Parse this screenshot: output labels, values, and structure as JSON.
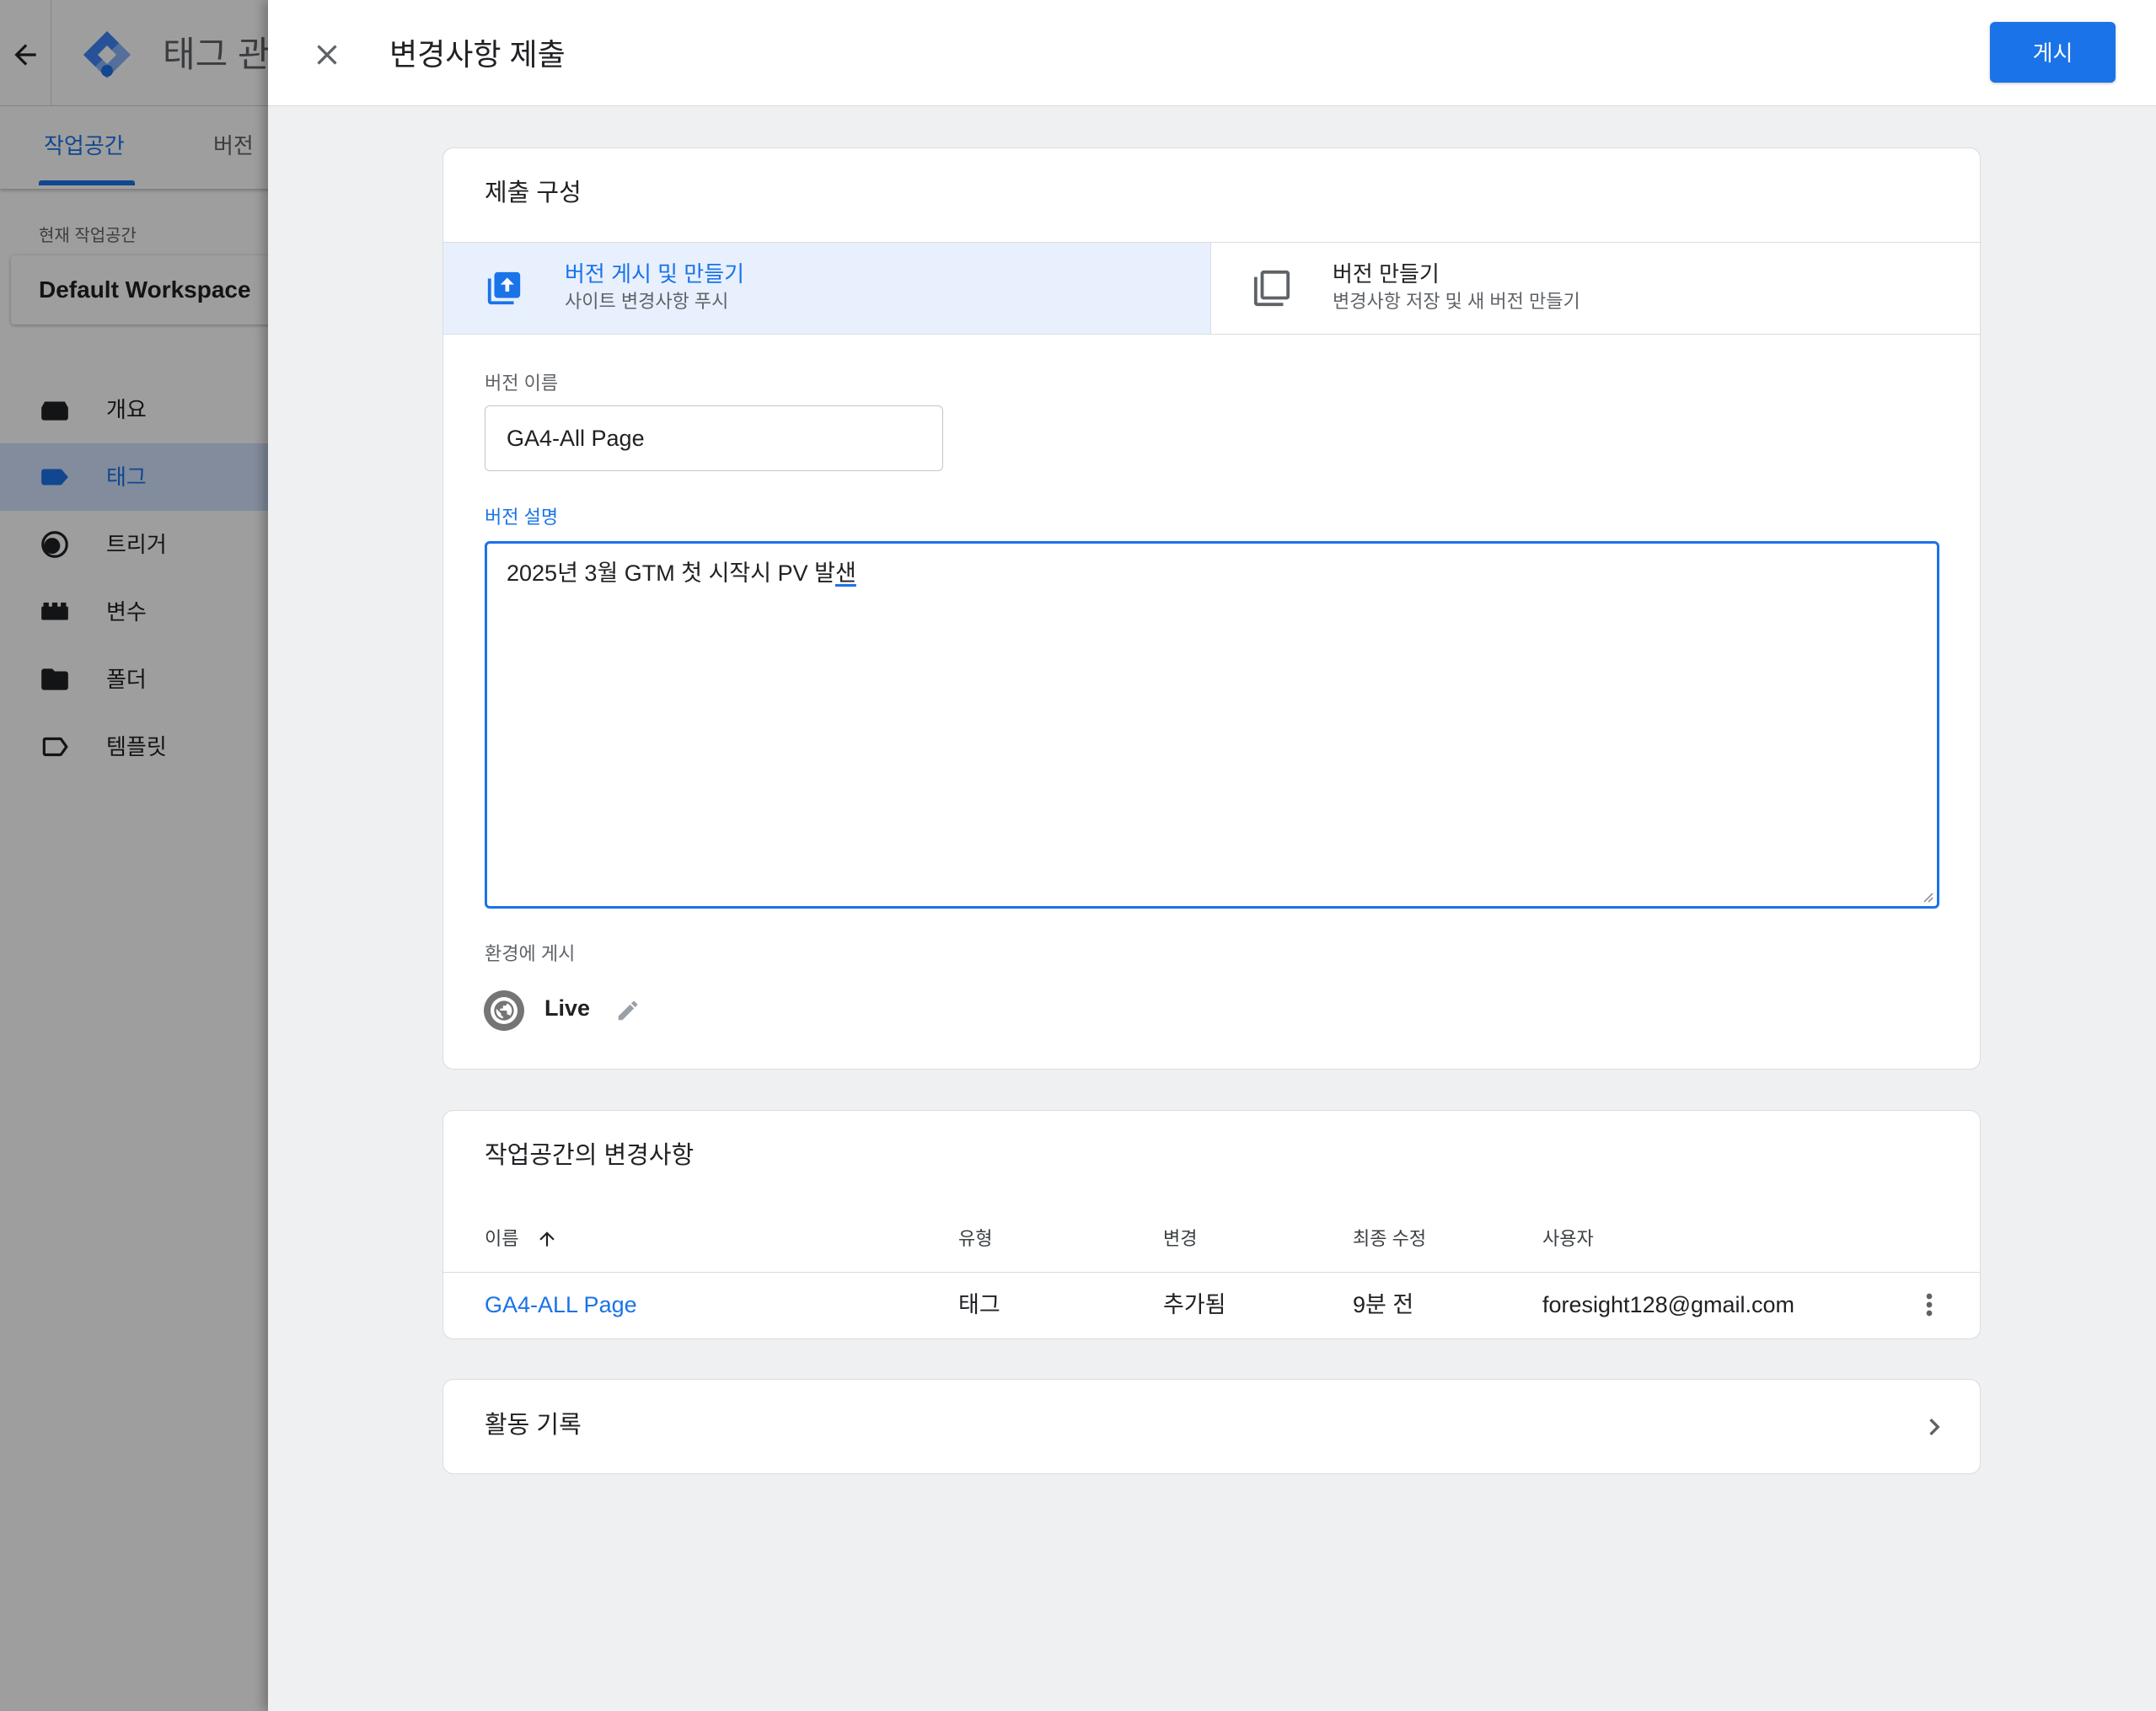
{
  "background": {
    "app_title": "태그 관",
    "tabs": [
      {
        "label": "작업공간",
        "active": true
      },
      {
        "label": "버전",
        "active": false
      }
    ],
    "current_workspace_label": "현재 작업공간",
    "workspace_name": "Default Workspace",
    "nav": [
      {
        "label": "개요",
        "icon": "overview-icon",
        "selected": false
      },
      {
        "label": "태그",
        "icon": "tag-icon",
        "selected": true
      },
      {
        "label": "트리거",
        "icon": "trigger-icon",
        "selected": false
      },
      {
        "label": "변수",
        "icon": "variable-icon",
        "selected": false
      },
      {
        "label": "폴더",
        "icon": "folder-icon",
        "selected": false
      },
      {
        "label": "템플릿",
        "icon": "template-icon",
        "selected": false
      }
    ]
  },
  "panel": {
    "title": "변경사항 제출",
    "close_icon": "close-icon",
    "publish_button": "게시",
    "config": {
      "heading": "제출 구성",
      "options": [
        {
          "title": "버전 게시 및 만들기",
          "subtitle": "사이트 변경사항 푸시",
          "icon": "publish-icon",
          "selected": true
        },
        {
          "title": "버전 만들기",
          "subtitle": "변경사항 저장 및 새 버전 만들기",
          "icon": "copy-icon",
          "selected": false
        }
      ],
      "version_name_label": "버전 이름",
      "version_name_value": "GA4-All Page",
      "version_description_label": "버전 설명",
      "version_description_committed": "2025년 3월 GTM 첫 시작시 PV 발",
      "version_description_composing": "샌",
      "environment_label": "환경에 게시",
      "environment_icon": "globe-icon",
      "environment_name": "Live",
      "environment_edit_icon": "pencil-icon"
    },
    "changes": {
      "heading": "작업공간의 변경사항",
      "columns": [
        "이름",
        "유형",
        "변경",
        "최종 수정",
        "사용자"
      ],
      "sort_icon": "arrow-up-icon",
      "rows": [
        {
          "name": "GA4-ALL Page",
          "type": "태그",
          "change": "추가됨",
          "modified": "9분 전",
          "user": "foresight128@gmail.com",
          "menu_icon": "more-vert-icon"
        }
      ]
    },
    "activity": {
      "heading": "활동 기록",
      "icon": "chevron-right-icon"
    }
  },
  "colors": {
    "accent": "#1a73e8",
    "selected_option_bg": "#e8f0fe",
    "selected_nav_bg": "#d2e3fc",
    "panel_bg": "#eef0f2",
    "border": "#dadce0"
  }
}
